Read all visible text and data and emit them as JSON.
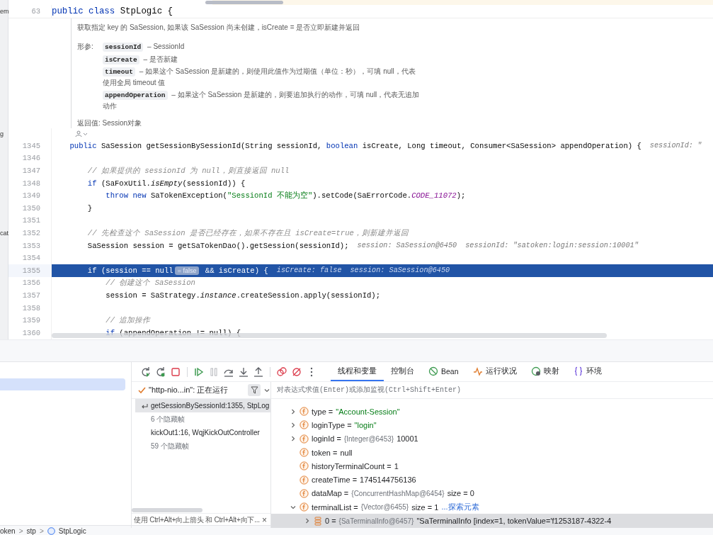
{
  "editor": {
    "sticky_line": {
      "number": "63",
      "edge_label": "em",
      "segments": [
        {
          "kind": "kw",
          "text": "public class "
        },
        {
          "kind": "plain",
          "text": "StpLogic {"
        }
      ]
    },
    "doc": {
      "summary": "获取指定 key 的 SaSession, 如果该 SaSession 尚未创建，isCreate = 是否立即新建并返回",
      "params_label": "形参:",
      "params": [
        {
          "name": "sessionId",
          "description": "– SessionId"
        },
        {
          "name": "isCreate",
          "description": "– 是否新建"
        },
        {
          "name": "timeout",
          "description": "– 如果这个 SaSession 是新建的，则使用此值作为过期值（单位：秒），可填 null，代表使用全局 timeout 值"
        },
        {
          "name": "appendOperation",
          "description": "– 如果这个 SaSession 是新建的，则要追加执行的动作，可填 null，代表无追加动作"
        }
      ],
      "returns_label": "返回值:",
      "returns": "Session对象"
    },
    "lens_edge_label": "g",
    "lines": [
      {
        "number": "1345",
        "current": false,
        "segments": [
          {
            "kind": "kw",
            "text": "    public "
          },
          {
            "kind": "plain",
            "text": "SaSession getSessionBySessionId(String sessionId, "
          },
          {
            "kind": "kw",
            "text": "boolean "
          },
          {
            "kind": "plain",
            "text": "isCreate, Long timeout, Consumer<SaSession> appendOperation) {"
          },
          {
            "kind": "hint",
            "text": "sessionId: \""
          }
        ]
      },
      {
        "number": "1346",
        "current": false
      },
      {
        "number": "1347",
        "current": false,
        "segments": [
          {
            "kind": "comment",
            "text": "        // 如果提供的 sessionId 为 null，则直接返回 null"
          }
        ]
      },
      {
        "number": "1348",
        "current": false,
        "segments": [
          {
            "kind": "kw",
            "text": "        if "
          },
          {
            "kind": "plain",
            "text": "(SaFoxUtil."
          },
          {
            "kind": "italic",
            "text": "isEmpty"
          },
          {
            "kind": "plain",
            "text": "(sessionId)) {"
          }
        ]
      },
      {
        "number": "1349",
        "current": false,
        "segments": [
          {
            "kind": "kw",
            "text": "            throw new "
          },
          {
            "kind": "plain",
            "text": "SaTokenException("
          },
          {
            "kind": "string",
            "text": "\"SessionId 不能为空\""
          },
          {
            "kind": "plain",
            "text": ").setCode(SaErrorCode."
          },
          {
            "kind": "const",
            "text": "CODE_11072"
          },
          {
            "kind": "plain",
            "text": ");"
          }
        ]
      },
      {
        "number": "1350",
        "current": false,
        "segments": [
          {
            "kind": "plain",
            "text": "        }"
          }
        ]
      },
      {
        "number": "1351",
        "current": false
      },
      {
        "number": "1352",
        "current": false,
        "edge_label": "cat",
        "segments": [
          {
            "kind": "comment",
            "text": "        // 先检查这个 SaSession 是否已经存在，如果不存在且 isCreate=true，则新建并返回"
          }
        ]
      },
      {
        "number": "1353",
        "current": false,
        "segments": [
          {
            "kind": "plain",
            "text": "        SaSession session = getSaTokenDao().getSession(sessionId);"
          },
          {
            "kind": "hint",
            "text": "session: SaSession@6450"
          },
          {
            "kind": "hint",
            "text": "sessionId: \"satoken:login:session:10001\""
          }
        ]
      },
      {
        "number": "1354",
        "current": false
      },
      {
        "number": "1355",
        "current": true,
        "segments": [
          {
            "kind": "kw",
            "text": "        if "
          },
          {
            "kind": "plain",
            "text": "(session == null"
          },
          {
            "kind": "badge",
            "text": "= false"
          },
          {
            "kind": "plain",
            "text": " && isCreate) {"
          },
          {
            "kind": "hint",
            "text": "isCreate: false"
          },
          {
            "kind": "hint",
            "text": "session: SaSession@6450"
          }
        ]
      },
      {
        "number": "1356",
        "current": false,
        "segments": [
          {
            "kind": "comment",
            "text": "            // 创建这个 SaSession"
          }
        ]
      },
      {
        "number": "1357",
        "current": false,
        "segments": [
          {
            "kind": "plain",
            "text": "            session = SaStrategy."
          },
          {
            "kind": "italic",
            "text": "instance"
          },
          {
            "kind": "plain",
            "text": ".createSession.apply(sessionId);"
          }
        ]
      },
      {
        "number": "1358",
        "current": false
      },
      {
        "number": "1359",
        "current": false,
        "segments": [
          {
            "kind": "comment",
            "text": "            // 追加操作"
          }
        ]
      },
      {
        "number": "1360",
        "current": false,
        "segments": [
          {
            "kind": "kw",
            "text": "            if "
          },
          {
            "kind": "plain",
            "text": "(appendOperation != null) {"
          }
        ]
      }
    ]
  },
  "debugger": {
    "tabs": [
      {
        "label": "线程和变量",
        "selected": true
      },
      {
        "label": "控制台",
        "selected": false
      },
      {
        "label": "Bean",
        "selected": false
      },
      {
        "label": "运行状况",
        "selected": false
      },
      {
        "label": "映射",
        "selected": false
      },
      {
        "label": "环境",
        "selected": false
      }
    ],
    "thread": {
      "label": "\"http-nio...in\": 正在运行"
    },
    "frames": [
      {
        "text": "getSessionBySessionId:1355, StpLog",
        "kind": "frame",
        "selected": true
      },
      {
        "text": "6 个隐藏帧",
        "kind": "hidden",
        "selected": false
      },
      {
        "text": "kickOut1:16, WqjKickOutController",
        "kind": "frame",
        "selected": false
      },
      {
        "text": "59 个隐藏帧",
        "kind": "hidden",
        "selected": false
      }
    ],
    "frames_hint": "使用 Ctrl+Alt+向上箭头 和 Ctrl+Alt+向下...",
    "frames_hint_close": "×",
    "eval": {
      "placeholder": "对表达式求值(Enter)或添加监视(Ctrl+Shift+Enter)"
    },
    "variables": [
      {
        "kind": "field",
        "label": "type =",
        "string_value": "\"Account-Session\"",
        "expandable": true,
        "expanded": false,
        "selected": false
      },
      {
        "kind": "field",
        "label": "loginType =",
        "string_value": "\"login\"",
        "expandable": true,
        "expanded": false,
        "selected": false
      },
      {
        "kind": "field",
        "label": "loginId =",
        "type_info": "{Integer@6453}",
        "value": "10001",
        "expandable": true,
        "expanded": false,
        "selected": false
      },
      {
        "kind": "field",
        "label": "token =",
        "value": "null",
        "expandable": false,
        "selected": false
      },
      {
        "kind": "field",
        "label": "historyTerminalCount =",
        "value": "1",
        "expandable": false,
        "selected": false
      },
      {
        "kind": "field",
        "label": "createTime =",
        "value": "1745144756136",
        "expandable": false,
        "selected": false
      },
      {
        "kind": "field",
        "label": "dataMap =",
        "type_info": "{ConcurrentHashMap@6454}",
        "value": "size = 0",
        "expandable": false,
        "selected": false
      },
      {
        "kind": "field",
        "label": "terminalList =",
        "type_info": "{Vector@6455}",
        "value": "size = 1",
        "link": "...探索元素",
        "expandable": true,
        "expanded": true,
        "selected": false,
        "children": [
          {
            "kind": "element",
            "label": "0 =",
            "type_info": "{SaTerminalInfo@6457}",
            "value": "\"SaTerminalInfo [index=1, tokenValue='f1253187-4322-4",
            "expandable": true,
            "expanded": false,
            "selected": true
          }
        ]
      }
    ]
  },
  "breadcrumb": [
    {
      "text": "oken",
      "kind": "text"
    },
    {
      "text": ">",
      "kind": "sep"
    },
    {
      "text": "stp",
      "kind": "text"
    },
    {
      "text": ">",
      "kind": "sep"
    },
    {
      "text": "StpLogic",
      "kind": "class"
    }
  ]
}
